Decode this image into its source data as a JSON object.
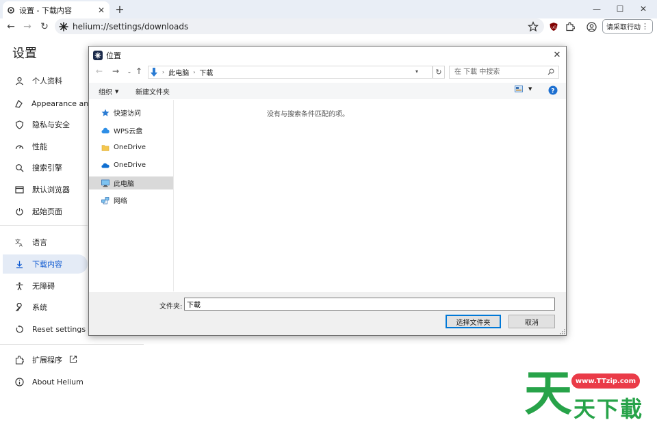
{
  "browser": {
    "tab_title": "设置 - 下载内容",
    "address": "helium://settings/downloads",
    "reading_button": "请采取行动"
  },
  "settings": {
    "title": "设置",
    "nav": [
      {
        "label": "个人资料",
        "icon": "person-icon"
      },
      {
        "label": "Appearance and",
        "icon": "appearance-icon"
      },
      {
        "label": "隐私与安全",
        "icon": "shield-icon"
      },
      {
        "label": "性能",
        "icon": "speedometer-icon"
      },
      {
        "label": "搜索引擎",
        "icon": "search-icon"
      },
      {
        "label": "默认浏览器",
        "icon": "browser-window-icon"
      },
      {
        "label": "起始页面",
        "icon": "power-icon"
      },
      {
        "label": "语言",
        "icon": "translate-icon"
      },
      {
        "label": "下载内容",
        "icon": "download-icon",
        "active": true
      },
      {
        "label": "无障碍",
        "icon": "accessibility-icon"
      },
      {
        "label": "系统",
        "icon": "wrench-icon"
      },
      {
        "label": "Reset settings",
        "icon": "reset-icon"
      },
      {
        "label": "扩展程序",
        "icon": "puzzle-icon"
      },
      {
        "label": "About Helium",
        "icon": "info-icon"
      }
    ]
  },
  "dialog": {
    "title": "位置",
    "breadcrumb": [
      "此电脑",
      "下載"
    ],
    "search_placeholder": "在 下載 中搜索",
    "organize_label": "组织",
    "new_folder_label": "新建文件夹",
    "nav_items": [
      {
        "label": "快速访问",
        "icon": "star-pin-icon"
      },
      {
        "label": "WPS云盘",
        "icon": "cloud-icon"
      },
      {
        "label": "OneDrive",
        "icon": "folder-icon"
      },
      {
        "label": "OneDrive",
        "icon": "onedrive-cloud-icon"
      },
      {
        "label": "此电脑",
        "icon": "computer-icon",
        "selected": true
      },
      {
        "label": "网络",
        "icon": "network-icon"
      }
    ],
    "empty_message": "没有与搜索条件匹配的项。",
    "folder_label": "文件夹:",
    "folder_value": "下載",
    "select_button": "选择文件夹",
    "cancel_button": "取消"
  },
  "watermark": {
    "url": "www.TTzip.com",
    "brand_glyph": "天",
    "brand_text": "天下載"
  },
  "colors": {
    "accent": "#0b57d0",
    "dialog_primary": "#0078d7",
    "watermark_green": "#27a349",
    "watermark_red": "#ea3b48"
  }
}
